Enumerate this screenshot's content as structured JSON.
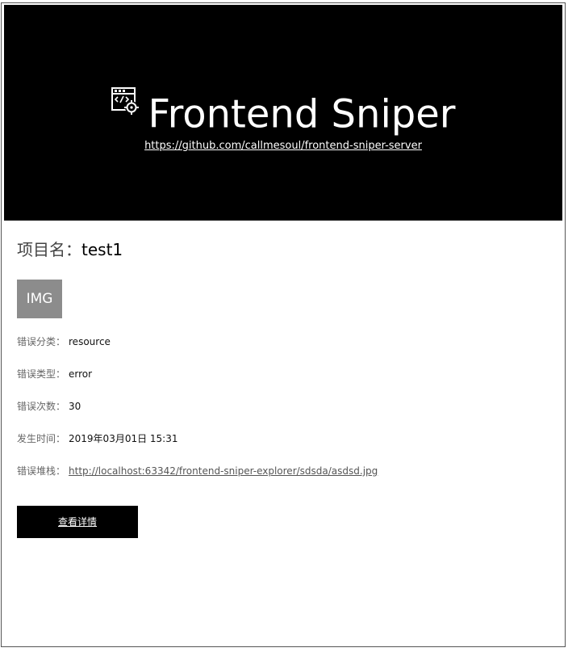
{
  "banner": {
    "logo_icon": "code-window-target-icon",
    "title": "Frontend Sniper",
    "repo_url": "https://github.com/callmesoul/frontend-sniper-server"
  },
  "project": {
    "label": "项目名：",
    "name": "test1"
  },
  "thumbnail": {
    "placeholder": "IMG"
  },
  "fields": {
    "category_label": "错误分类：",
    "category_value": "resource",
    "type_label": "错误类型：",
    "type_value": "error",
    "count_label": "错误次数：",
    "count_value": "30",
    "time_label": "发生时间：",
    "time_value": "2019年03月01日 15:31",
    "stack_label": "错误堆栈：",
    "stack_value": "http://localhost:63342/frontend-sniper-explorer/sdsda/asdsd.jpg"
  },
  "actions": {
    "detail_label": "查看详情"
  },
  "colors": {
    "banner_bg": "#000000",
    "banner_text": "#ffffff",
    "img_placeholder_bg": "#8c8c8c",
    "button_bg": "#000000"
  }
}
